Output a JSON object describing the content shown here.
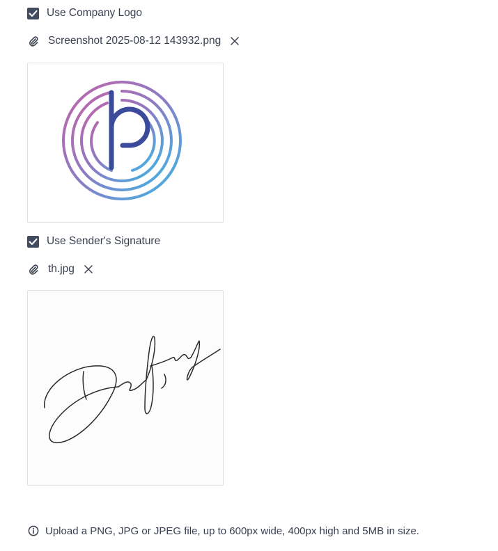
{
  "logo_section": {
    "checkbox_label": "Use Company Logo",
    "checked": true,
    "file_name": "Screenshot 2025-08-12 143932.png",
    "attachment_icon": "paperclip-icon",
    "remove_icon": "close-icon",
    "preview_image": "company-logo"
  },
  "signature_section": {
    "checkbox_label": "Use Sender's Signature",
    "checked": true,
    "file_name": "th.jpg",
    "attachment_icon": "paperclip-icon",
    "remove_icon": "close-icon",
    "preview_image": "handwritten-signature"
  },
  "help": {
    "icon": "info-icon",
    "text": "Upload a PNG, JPG or JPEG file, up to 600px wide, 400px high and 5MB in size."
  },
  "colors": {
    "checkbox_fill": "#424a60",
    "text": "#3a4052",
    "border": "#dcdfe4",
    "logo_gradient_start": "#c462a8",
    "logo_gradient_end": "#3cb8e8",
    "logo_letter": "#3b4b9c"
  }
}
